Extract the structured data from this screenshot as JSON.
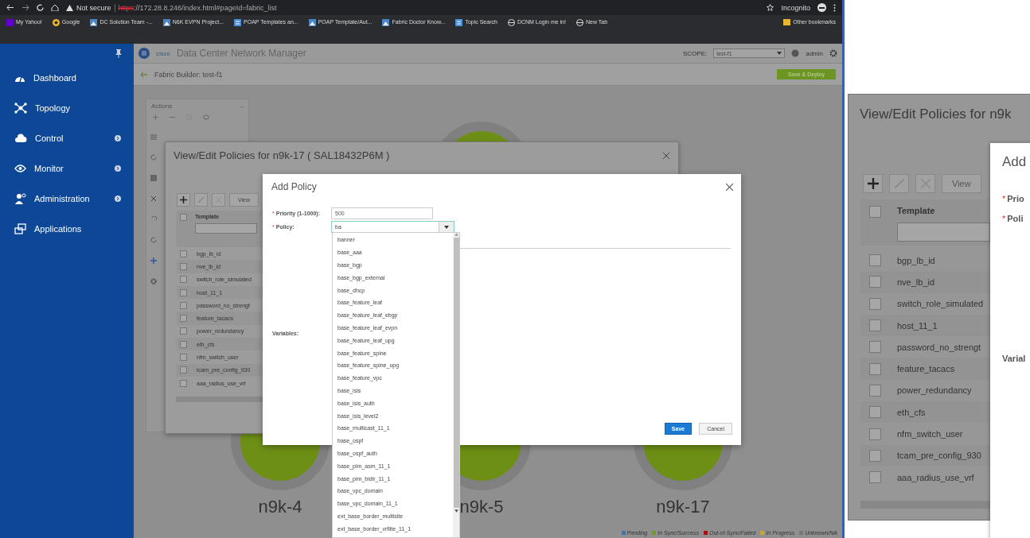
{
  "browser": {
    "url_warning": "Not secure",
    "url_scheme": "https",
    "url_rest": "://172.28.8.246/index.html#pageId=fabric_list",
    "profile": "Incognito",
    "other_bookmarks": "Other bookmarks",
    "bookmarks": [
      {
        "label": "My Yahoo!",
        "kind": "yahoo"
      },
      {
        "label": "Google",
        "kind": "google"
      },
      {
        "label": "DC Solution Team -...",
        "kind": "site"
      },
      {
        "label": "N6K EVPN Project...",
        "kind": "site"
      },
      {
        "label": "POAP Templates an...",
        "kind": "doc"
      },
      {
        "label": "POAP Template/Aut...",
        "kind": "site"
      },
      {
        "label": "Fabric Doctor Know...",
        "kind": "site"
      },
      {
        "label": "Topic Search",
        "kind": "doc"
      },
      {
        "label": "DCNM Login me in!",
        "kind": "globe"
      },
      {
        "label": "New Tab",
        "kind": "globe"
      }
    ]
  },
  "sidebar": {
    "items": [
      {
        "label": "Dashboard",
        "kind": "dashboard",
        "has_submenu": false
      },
      {
        "label": "Topology",
        "kind": "topology",
        "has_submenu": false
      },
      {
        "label": "Control",
        "kind": "cloud",
        "has_submenu": true
      },
      {
        "label": "Monitor",
        "kind": "eye",
        "has_submenu": true
      },
      {
        "label": "Administration",
        "kind": "admin",
        "has_submenu": true
      },
      {
        "label": "Applications",
        "kind": "apps",
        "has_submenu": false
      }
    ]
  },
  "header": {
    "logo": "cisco",
    "title": "Data Center Network Manager",
    "scope_label": "SCOPE:",
    "scope_value": "test-f1",
    "user": "admin"
  },
  "fabric": {
    "title": "Fabric Builder: test-f1",
    "deploy_button": "Save & Deploy",
    "actions_title": "Actions",
    "actions_collapse": "–"
  },
  "nodes": [
    {
      "label": "n9k-4"
    },
    {
      "label": "n9k-5"
    },
    {
      "label": "n9k-17"
    }
  ],
  "legend": [
    {
      "label": "Pending",
      "color": "#3b72b8"
    },
    {
      "label": "In Sync/Success",
      "color": "#6e9a1e"
    },
    {
      "label": "Out-of-Sync/Failed",
      "color": "#a80f0f"
    },
    {
      "label": "In Progress",
      "color": "#d8a512"
    },
    {
      "label": "Unknown/NA",
      "color": "#777777"
    }
  ],
  "policies_dialog": {
    "title": "View/Edit Policies for n9k-17 ( SAL18432P6M )",
    "view_button": "View",
    "column": "Template",
    "all_checked": false,
    "rows": [
      {
        "template": "bgp_lb_id",
        "checked": false
      },
      {
        "template": "nve_lb_id",
        "checked": false
      },
      {
        "template": "switch_role_simulated",
        "checked": false
      },
      {
        "template": "host_11_1",
        "checked": false
      },
      {
        "template": "password_no_strengt",
        "checked": false
      },
      {
        "template": "feature_tacacs",
        "checked": false
      },
      {
        "template": "power_redundancy",
        "checked": false
      },
      {
        "template": "eth_cfs",
        "checked": false
      },
      {
        "template": "nfm_switch_user",
        "checked": false
      },
      {
        "template": "tcam_pre_config_930",
        "checked": false
      },
      {
        "template": "aaa_radius_use_vrf",
        "checked": false
      }
    ]
  },
  "add_policy": {
    "title": "Add Policy",
    "fields": [
      {
        "mark": "*",
        "label": "Priority (1-1000):",
        "value": "500"
      },
      {
        "mark": "*",
        "label": "Policy:",
        "value": "ba"
      }
    ],
    "variables_label": "Variables:",
    "save": "Save",
    "cancel": "Cancel",
    "options": [
      "banner",
      "base_aaa",
      "base_bgp",
      "base_bgp_external",
      "base_dhcp",
      "base_feature_leaf",
      "base_feature_leaf_ebgp",
      "base_feature_leaf_evpn",
      "base_feature_leaf_upg",
      "base_feature_spine",
      "base_feature_spine_upg",
      "base_feature_vpc",
      "base_isis",
      "base_isis_auth",
      "base_isis_level2",
      "base_multicast_11_1",
      "base_ospf",
      "base_ospf_auth",
      "base_pim_asm_11_1",
      "base_pim_bidir_11_1",
      "base_vpc_domain",
      "base_vpc_domain_11_1",
      "ext_base_border_multisite",
      "ext_base_border_vrflite_11_1"
    ]
  },
  "zoom_inset": {
    "title": "View/Edit Policies for n9k",
    "view_button": "View",
    "column": "Template",
    "all_checked": false,
    "rows": [
      {
        "template": "bgp_lb_id",
        "checked": false
      },
      {
        "template": "nve_lb_id",
        "checked": false
      },
      {
        "template": "switch_role_simulated",
        "checked": false
      },
      {
        "template": "host_11_1",
        "checked": false
      },
      {
        "template": "password_no_strengt",
        "checked": false
      },
      {
        "template": "feature_tacacs",
        "checked": false
      },
      {
        "template": "power_redundancy",
        "checked": false
      },
      {
        "template": "eth_cfs",
        "checked": false
      },
      {
        "template": "nfm_switch_user",
        "checked": false
      },
      {
        "template": "tcam_pre_config_930",
        "checked": false
      },
      {
        "template": "aaa_radius_use_vrf",
        "checked": false
      }
    ],
    "add_title": "Add",
    "fields": [
      {
        "mark": "*",
        "label": "Prio"
      },
      {
        "mark": "*",
        "label": "Poli"
      }
    ],
    "variables_label": "Varial"
  }
}
